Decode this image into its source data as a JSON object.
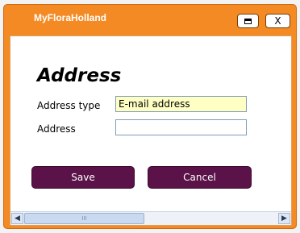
{
  "window": {
    "title": "MyFloraHolland",
    "restore_icon": "restore-icon",
    "close_label": "X"
  },
  "form": {
    "heading": "Address",
    "address_type_label": "Address type",
    "address_type_value": "E-mail address",
    "address_label": "Address",
    "address_value": ""
  },
  "buttons": {
    "save_label": "Save",
    "cancel_label": "Cancel"
  },
  "scrollbar": {
    "left_icon": "arrow-left-icon",
    "right_icon": "arrow-right-icon",
    "grip": "III"
  },
  "colors": {
    "frame": "#f48a24",
    "button": "#5a1248",
    "highlight_field": "#ffffc4"
  }
}
